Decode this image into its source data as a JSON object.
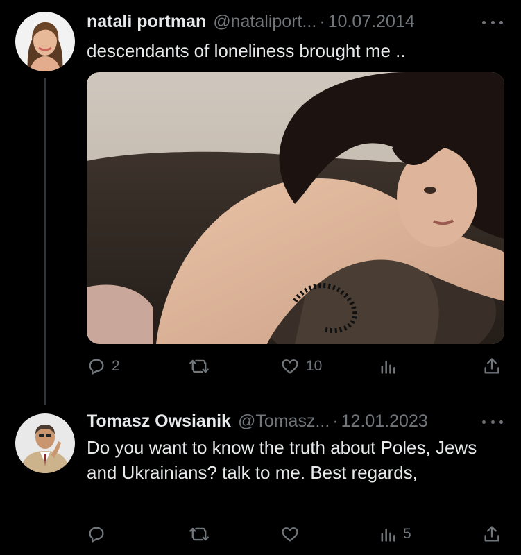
{
  "tweets": [
    {
      "name": "natali portman",
      "handle": "@nataliport...",
      "date": "10.07.2014",
      "text": "descendants of loneliness brought me ..",
      "media": "photo of a dark-haired woman leaning over a dark leather chair",
      "actions": {
        "replies": "2",
        "retweets": "",
        "likes": "10",
        "views": ""
      }
    },
    {
      "name": "Tomasz Owsianik",
      "handle": "@Tomasz...",
      "date": "12.01.2023",
      "text": "Do you want to know the truth about Poles, Jews and Ukrainians? talk to me. Best regards,",
      "actions": {
        "replies": "",
        "retweets": "",
        "likes": "",
        "views": "5"
      }
    }
  ],
  "separator": "·",
  "colors": {
    "background": "#000000",
    "text": "#e7e9ea",
    "muted": "#71767b",
    "thread_line": "#333639"
  },
  "icons": [
    "reply-icon",
    "retweet-icon",
    "like-icon",
    "views-icon",
    "share-icon",
    "more-icon"
  ]
}
